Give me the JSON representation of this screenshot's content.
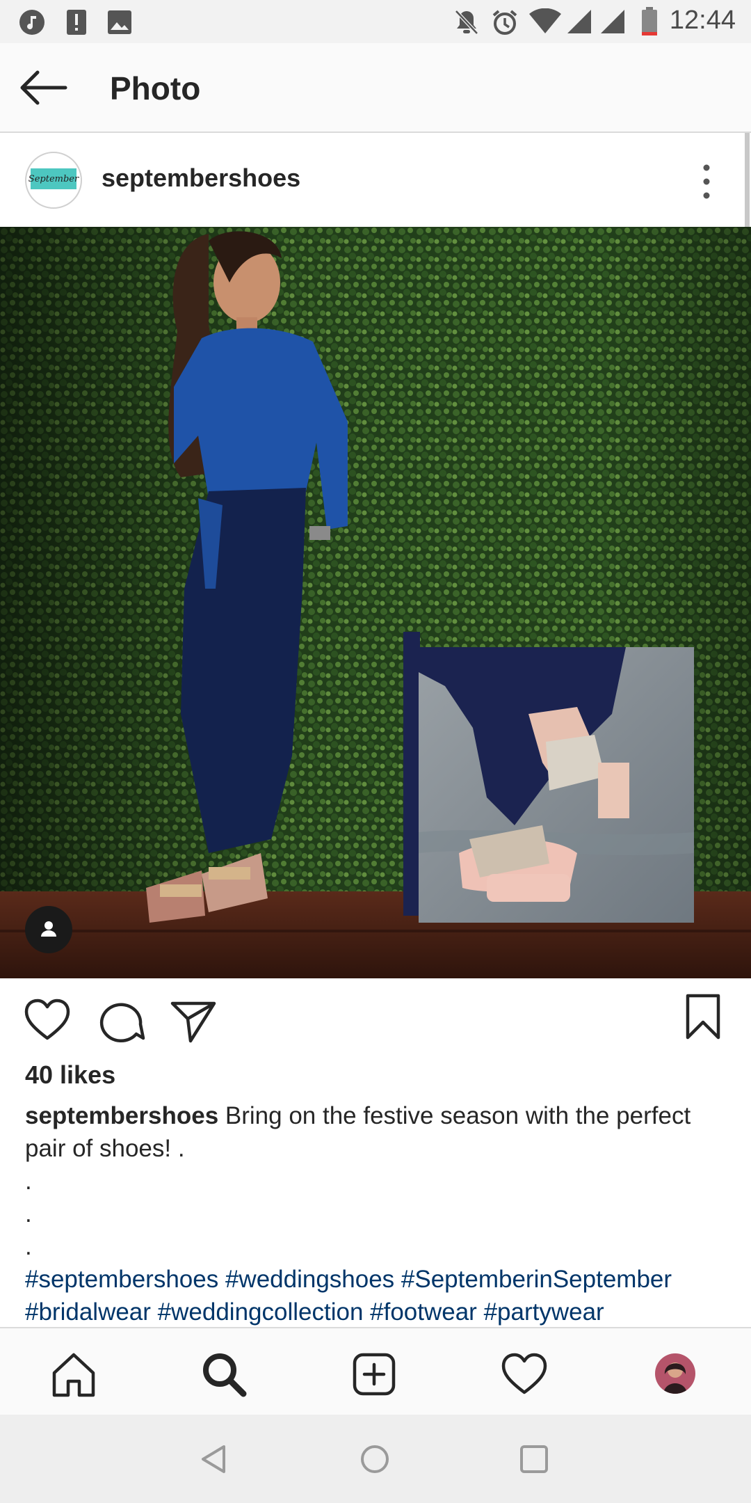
{
  "status_bar": {
    "time": "12:44",
    "left_icons": [
      "music-icon",
      "alert-icon",
      "image-icon"
    ],
    "right_icons": [
      "mute-icon",
      "alarm-icon",
      "wifi-icon",
      "signal-icon",
      "signal-icon",
      "battery-icon"
    ]
  },
  "app_bar": {
    "title": "Photo"
  },
  "post": {
    "username": "septembershoes",
    "avatar_text": "September",
    "likes": "40 likes",
    "caption": {
      "username": "septembershoes",
      "text": " Bring on the festive season with the perfect pair of shoes! .",
      "dots": [
        ".",
        ".",
        "."
      ],
      "hashtags_line1": "#septembershoes #weddingshoes #SeptemberinSeptember",
      "hashtags_line2": "#bridalwear #weddingcollection #footwear #partywear"
    }
  },
  "colors": {
    "hashtag": "#003569",
    "text": "#262626",
    "brand_teal": "#4dc7c0"
  }
}
